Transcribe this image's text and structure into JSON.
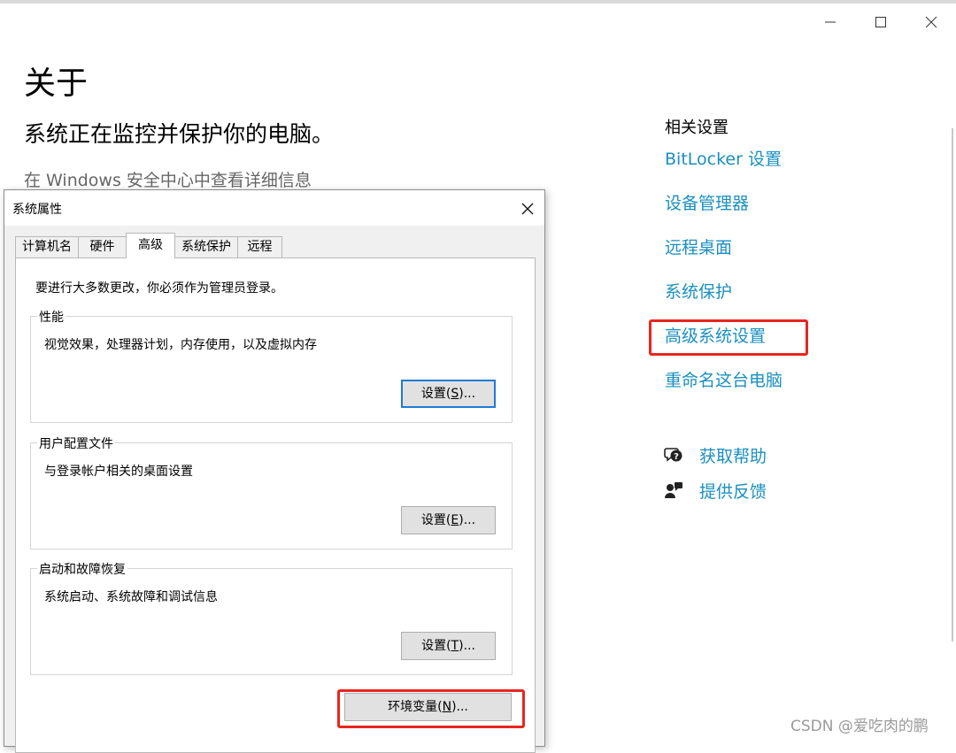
{
  "window": {
    "controls": [
      "minimize",
      "maximize",
      "close"
    ]
  },
  "settings": {
    "title": "关于",
    "protect_status": "系统正在监控并保护你的电脑。",
    "security_link": "在 Windows 安全中心中查看详细信息"
  },
  "related": {
    "heading": "相关设置",
    "links": [
      {
        "label": "BitLocker 设置"
      },
      {
        "label": "设备管理器"
      },
      {
        "label": "远程桌面"
      },
      {
        "label": "系统保护"
      },
      {
        "label": "高级系统设置",
        "highlighted": true
      },
      {
        "label": "重命名这台电脑"
      }
    ],
    "help": [
      {
        "label": "获取帮助",
        "icon": "help-chat-icon"
      },
      {
        "label": "提供反馈",
        "icon": "feedback-person-icon"
      }
    ]
  },
  "dialog": {
    "title": "系统属性",
    "tabs": [
      {
        "label": "计算机名"
      },
      {
        "label": "硬件"
      },
      {
        "label": "高级",
        "active": true
      },
      {
        "label": "系统保护"
      },
      {
        "label": "远程"
      }
    ],
    "admin_note": "要进行大多数更改，你必须作为管理员登录。",
    "groups": [
      {
        "label": "性能",
        "description": "视觉效果，处理器计划，内存使用，以及虚拟内存",
        "button_prefix": "设置(",
        "button_key": "S",
        "button_suffix": ")..."
      },
      {
        "label": "用户配置文件",
        "description": "与登录帐户相关的桌面设置",
        "button_prefix": "设置(",
        "button_key": "E",
        "button_suffix": ")..."
      },
      {
        "label": "启动和故障恢复",
        "description": "系统启动、系统故障和调试信息",
        "button_prefix": "设置(",
        "button_key": "T",
        "button_suffix": ")..."
      }
    ],
    "env_button": {
      "prefix": "环境变量(",
      "key": "N",
      "suffix": ")..."
    }
  },
  "colors": {
    "link": "#1a8fbf",
    "highlight_box": "#e8251f",
    "default_button_border": "#1e7bd6"
  },
  "watermark": "CSDN @爱吃肉的鹏"
}
